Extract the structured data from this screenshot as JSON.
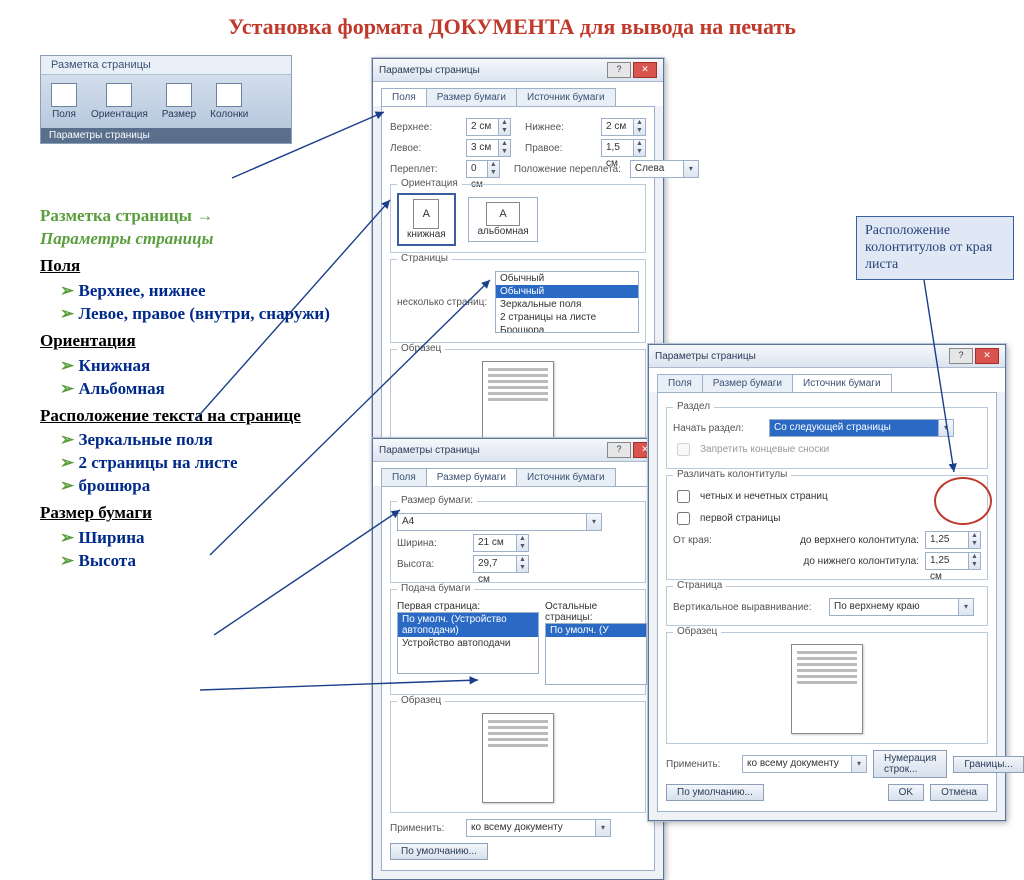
{
  "title": "Установка формата ДОКУМЕНТА для вывода на печать",
  "ribbon": {
    "tab": "Разметка страницы",
    "buttons": [
      "Поля",
      "Ориентация",
      "Размер",
      "Колонки"
    ],
    "footer": "Параметры страницы"
  },
  "outline": {
    "path1": "Разметка страницы →",
    "path2": "Параметры страницы",
    "s1": "Поля",
    "s1items": [
      "Верхнее, нижнее",
      "Левое, правое (внутри, снаружи)"
    ],
    "s2": "Ориентация",
    "s2items": [
      "Книжная",
      "Альбомная"
    ],
    "s3": "Расположение текста на странице",
    "s3items": [
      "Зеркальные поля",
      "2 страницы на листе",
      "брошюра"
    ],
    "s4": "Размер бумаги",
    "s4items": [
      "Ширина",
      "Высота"
    ]
  },
  "dlg": {
    "title": "Параметры страницы",
    "tabs": [
      "Поля",
      "Размер бумаги",
      "Источник бумаги"
    ],
    "fields": {
      "top": "Верхнее:",
      "top_v": "2 см",
      "bottom": "Нижнее:",
      "bottom_v": "2 см",
      "left": "Левое:",
      "left_v": "3 см",
      "right": "Правое:",
      "right_v": "1,5 см",
      "gutter": "Переплет:",
      "gutter_v": "0 см",
      "gutterpos": "Положение переплета:",
      "gutterpos_v": "Слева"
    },
    "orient_label": "Ориентация",
    "orient_portrait": "книжная",
    "orient_landscape": "альбомная",
    "pages_label": "Страницы",
    "multipages": "несколько страниц:",
    "mp_options": [
      "Обычный",
      "Обычный",
      "Зеркальные поля",
      "2 страницы на листе",
      "Брошюра"
    ],
    "sample": "Образец",
    "apply": "Применить:",
    "apply_v": "ко всему документу",
    "default": "По умолчанию...",
    "ok": "OK",
    "cancel": "Отмена"
  },
  "dlg2": {
    "papersize": "Размер бумаги:",
    "paper_v": "A4",
    "width": "Ширина:",
    "width_v": "21 см",
    "height": "Высота:",
    "height_v": "29,7 см",
    "feed": "Подача бумаги",
    "first": "Первая страница:",
    "other": "Остальные страницы:",
    "opt_hl": "По умолч. (Устройство автоподачи)",
    "opt2": "Устройство автоподачи",
    "opt_other": "По умолч. (У"
  },
  "dlg3": {
    "section": "Раздел",
    "start": "Начать раздел:",
    "start_v": "Со следующей страницы",
    "endnotes": "Запретить концевые сноски",
    "headers": "Различать колонтитулы",
    "odd_even": "четных и нечетных страниц",
    "first_page": "первой страницы",
    "fromedge": "От края:",
    "tohdr": "до верхнего колонтитула:",
    "tohdr_v": "1,25 см",
    "toftr": "до нижнего колонтитула:",
    "toftr_v": "1,25 см",
    "page": "Страница",
    "valign": "Вертикальное выравнивание:",
    "valign_v": "По верхнему краю",
    "linenum": "Нумерация строк...",
    "borders": "Границы..."
  },
  "callout": "Расположение колонтитулов от края листа"
}
